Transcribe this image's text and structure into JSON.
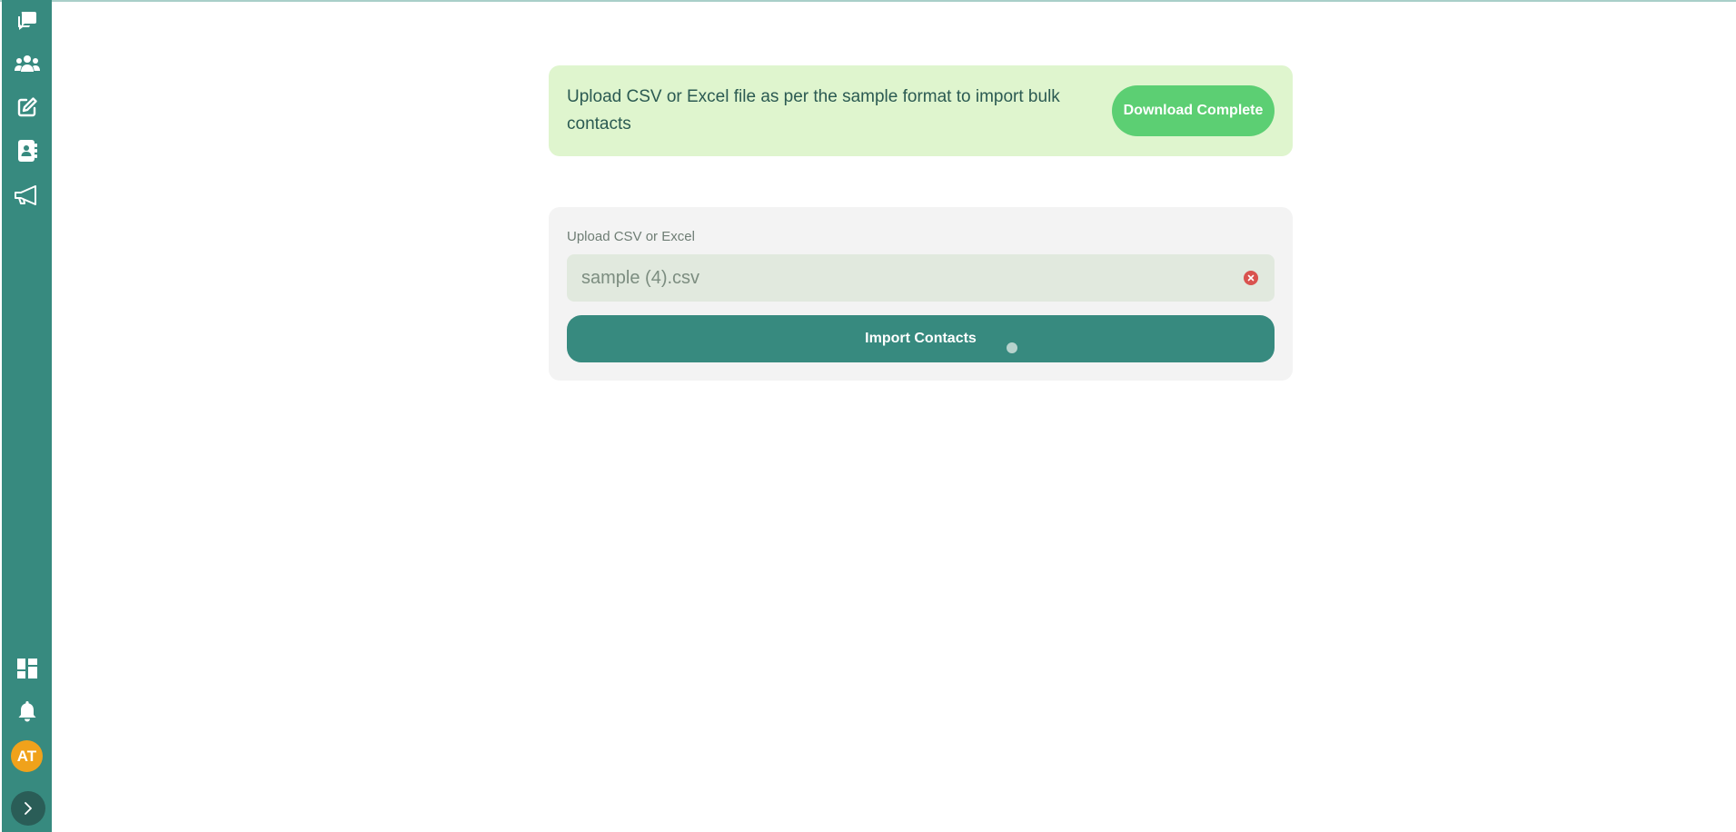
{
  "sidebar": {
    "top_icons": [
      "chat-icon",
      "users-group-icon",
      "edit-icon",
      "contacts-book-icon",
      "megaphone-icon"
    ],
    "bottom_icons": [
      "dashboard-icon",
      "bell-icon"
    ],
    "avatar_initials": "AT",
    "expand_icon": "chevron-right-icon"
  },
  "banner": {
    "text": "Upload CSV or Excel file as per the sample format to import bulk contacts",
    "download_label": "Download Complete"
  },
  "upload": {
    "label": "Upload CSV or Excel",
    "file_name": "sample (4).csv",
    "clear_icon": "close-circle-icon",
    "import_label": "Import Contacts"
  },
  "colors": {
    "sidebar": "#378a7f",
    "banner_bg": "#dff5ce",
    "download_button": "#5ccf73",
    "avatar": "#f0a21b",
    "clear_icon": "#d9534f"
  }
}
